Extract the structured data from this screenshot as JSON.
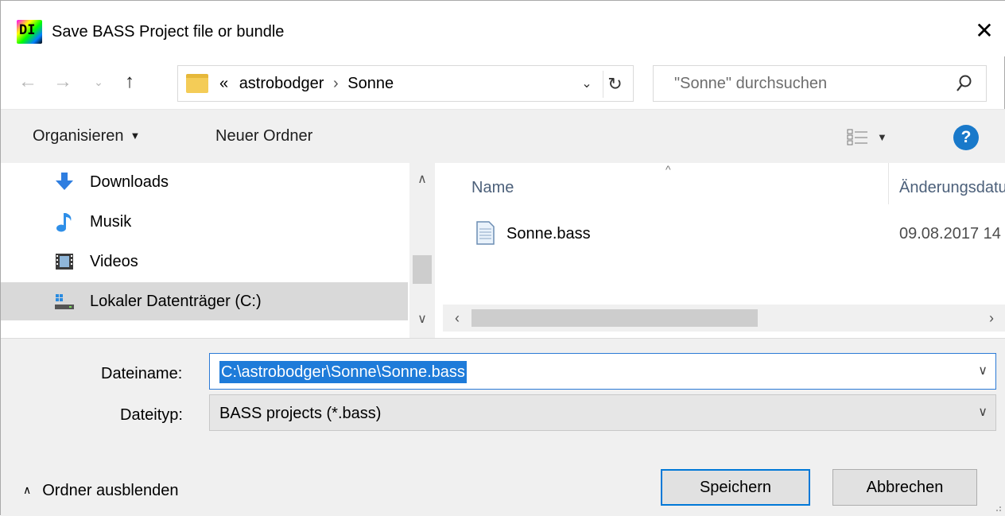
{
  "window": {
    "title": "Save BASS Project file or bundle"
  },
  "address": {
    "overflow": "«",
    "crumbs": [
      "astrobodger",
      "Sonne"
    ],
    "separator": "›"
  },
  "search": {
    "placeholder": "\"Sonne\" durchsuchen"
  },
  "toolbar": {
    "organize_label": "Organisieren",
    "new_folder_label": "Neuer Ordner"
  },
  "nav": {
    "items": [
      {
        "label": "Downloads",
        "icon": "download-icon"
      },
      {
        "label": "Musik",
        "icon": "music-icon"
      },
      {
        "label": "Videos",
        "icon": "video-icon"
      },
      {
        "label": "Lokaler Datenträger (C:)",
        "icon": "drive-icon",
        "selected": true
      }
    ]
  },
  "files": {
    "columns": {
      "name": "Name",
      "date": "Änderungsdatum"
    },
    "rows": [
      {
        "name": "Sonne.bass",
        "date": "09.08.2017 14"
      }
    ]
  },
  "form": {
    "filename_label": "Dateiname:",
    "filename_value": "C:\\astrobodger\\Sonne\\Sonne.bass",
    "filetype_label": "Dateityp:",
    "filetype_value": "BASS projects (*.bass)"
  },
  "footer": {
    "hide_folders_label": "Ordner ausblenden",
    "save_label": "Speichern",
    "cancel_label": "Abbrechen"
  },
  "colors": {
    "accent": "#0078d7",
    "selection": "#1e7bd9",
    "help": "#1979ca"
  }
}
